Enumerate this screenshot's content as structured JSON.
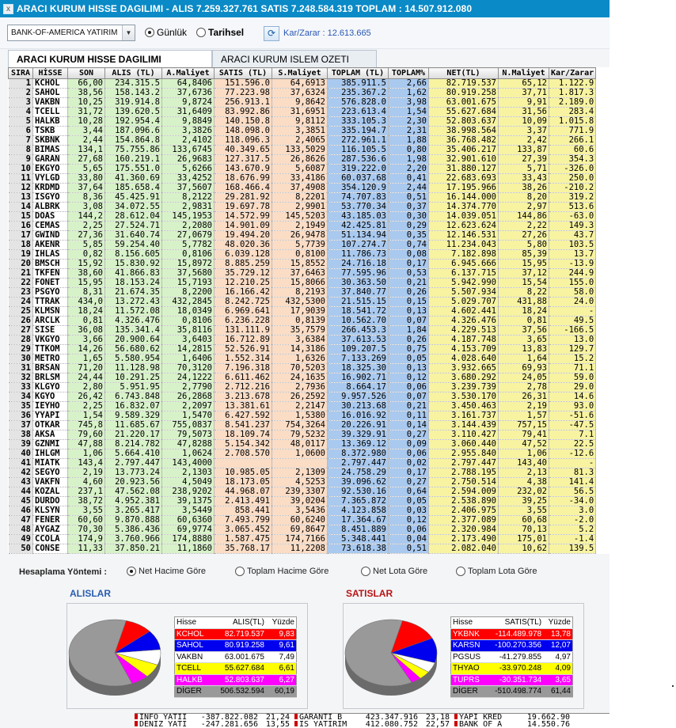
{
  "window": {
    "title": "ARACI KURUM HISSE DAGILIMI - ALIS 7.259.327.761  SATIS 7.248.584.319  TOPLAM : 14.507.912.080",
    "close_glyph": "x"
  },
  "toolbar": {
    "broker_select": "BANK-OF-AMERICA YATIRIM",
    "radio_gunluk": "Günlük",
    "radio_tarihsel": "Tarihsel",
    "selected_mode": "Günlük",
    "kar_zarar": "Kar/Zarar : 12.613.665"
  },
  "tabs": [
    {
      "label": "ARACI KURUM HISSE DAGILIMI",
      "active": true
    },
    {
      "label": "ARACI KURUM ISLEM OZETI",
      "active": false
    }
  ],
  "grid": {
    "columns": [
      "SIRA",
      "HİSSE",
      "SON",
      "ALIS (TL)",
      "A.Maliyet",
      "SATIS (TL)",
      "S.Maliyet",
      "TOPLAM (TL)",
      "TOPLAM%",
      "NET(TL)",
      "N.Maliyet",
      "Kar/Zarar"
    ],
    "rows": [
      [
        "1",
        "KCHOL",
        "66,00",
        "234.315.5",
        "64,8406",
        "151.596.0",
        "64,6913",
        "385.911.5",
        "2,66",
        "82.719.537",
        "65,12",
        "1.122.9"
      ],
      [
        "2",
        "SAHOL",
        "38,56",
        "158.143.2",
        "37,6736",
        "77.223.98",
        "37,6324",
        "235.367.2",
        "1,62",
        "80.919.258",
        "37,71",
        "1.817.3"
      ],
      [
        "3",
        "VAKBN",
        "10,25",
        "319.914.8",
        "9,8724",
        "256.913.1",
        "9,8642",
        "576.828.0",
        "3,98",
        "63.001.675",
        "9,91",
        "2.189.0"
      ],
      [
        "4",
        "TCELL",
        "31,72",
        "139.620.5",
        "31,6409",
        "83.992.86",
        "31,6951",
        "223.613.4",
        "1,54",
        "55.627.684",
        "31,56",
        "283.4"
      ],
      [
        "5",
        "HALKB",
        "10,28",
        "192.954.4",
        "9,8849",
        "140.150.8",
        "9,8112",
        "333.105.3",
        "2,30",
        "52.803.637",
        "10,09",
        "1.015.8"
      ],
      [
        "6",
        "TSKB",
        "3,44",
        "187.096.6",
        "3,3826",
        "148.098.0",
        "3,3851",
        "335.194.7",
        "2,31",
        "38.998.564",
        "3,37",
        "771.9"
      ],
      [
        "7",
        "SKBNK",
        "2,44",
        "154.864.8",
        "2,4102",
        "118.096.3",
        "2,4065",
        "272.961.1",
        "1,88",
        "36.768.482",
        "2,42",
        "266.1"
      ],
      [
        "8",
        "BIMAS",
        "134,1",
        "75.755.86",
        "133,6745",
        "40.349.65",
        "133,5029",
        "116.105.5",
        "0,80",
        "35.406.217",
        "133,87",
        "60.6"
      ],
      [
        "9",
        "GARAN",
        "27,68",
        "160.219.1",
        "26,9683",
        "127.317.5",
        "26,8626",
        "287.536.6",
        "1,98",
        "32.901.610",
        "27,39",
        "354.3"
      ],
      [
        "10",
        "EKGYO",
        "5,65",
        "175.551.0",
        "5,6266",
        "143.670.9",
        "5,6087",
        "319.222.0",
        "2,20",
        "31.880.127",
        "5,71",
        "-326.0"
      ],
      [
        "11",
        "VYLGD",
        "33,80",
        "41.360.69",
        "33,4252",
        "18.676.99",
        "33,4186",
        "60.037.68",
        "0,41",
        "22.683.693",
        "33,43",
        "250.0"
      ],
      [
        "12",
        "KRDMD",
        "37,64",
        "185.658.4",
        "37,5607",
        "168.466.4",
        "37,4908",
        "354.120.9",
        "2,44",
        "17.195.966",
        "38,26",
        "-210.2"
      ],
      [
        "13",
        "ISGYO",
        "8,36",
        "45.425.91",
        "8,2122",
        "29.281.92",
        "8,2201",
        "74.707.83",
        "0,51",
        "16.144.000",
        "8,20",
        "319.2"
      ],
      [
        "14",
        "ALBRK",
        "3,08",
        "34.072.55",
        "2,9831",
        "19.697.78",
        "2,9901",
        "53.770.34",
        "0,37",
        "14.374.770",
        "2,97",
        "513.6"
      ],
      [
        "15",
        "DOAS",
        "144,2",
        "28.612.04",
        "145,1953",
        "14.572.99",
        "145,5203",
        "43.185.03",
        "0,30",
        "14.039.051",
        "144,86",
        "-63.0"
      ],
      [
        "16",
        "CEMAS",
        "2,25",
        "27.524.71",
        "2,2080",
        "14.901.09",
        "2,1949",
        "42.425.81",
        "0,29",
        "12.623.624",
        "2,22",
        "149.3"
      ],
      [
        "17",
        "GWIND",
        "27,36",
        "31.640.74",
        "27,0679",
        "19.494.20",
        "26,9478",
        "51.134.94",
        "0,35",
        "12.146.531",
        "27,26",
        "43.7"
      ],
      [
        "18",
        "AKENR",
        "5,85",
        "59.254.40",
        "5,7782",
        "48.020.36",
        "5,7739",
        "107.274.7",
        "0,74",
        "11.234.043",
        "5,80",
        "103.5"
      ],
      [
        "19",
        "IHLAS",
        "0,82",
        "8.156.605",
        "0,8106",
        "6.039.128",
        "0,8100",
        "11.786.73",
        "0,08",
        "7.182.898",
        "85,39",
        "13.7"
      ],
      [
        "20",
        "BMSCH",
        "15,92",
        "15.830.92",
        "15,8972",
        "8.885.259",
        "15,8552",
        "24.716.18",
        "0,17",
        "6.945.666",
        "15,95",
        "-13.9"
      ],
      [
        "21",
        "TKFEN",
        "38,60",
        "41.866.83",
        "37,5680",
        "35.729.12",
        "37,6463",
        "77.595.96",
        "0,53",
        "6.137.715",
        "37,12",
        "244.9"
      ],
      [
        "22",
        "FONET",
        "15,95",
        "18.153.24",
        "15,7193",
        "12.210.25",
        "15,8066",
        "30.363.50",
        "0,21",
        "5.942.990",
        "15,54",
        "155.0"
      ],
      [
        "23",
        "PSGYO",
        "8,31",
        "21.674.35",
        "8,2200",
        "16.166.42",
        "8,2193",
        "37.840.77",
        "0,26",
        "5.507.934",
        "8,22",
        "58.0"
      ],
      [
        "24",
        "TTRAK",
        "434,0",
        "13.272.43",
        "432,2845",
        "8.242.725",
        "432,5300",
        "21.515.15",
        "0,15",
        "5.029.707",
        "431,88",
        "24.0"
      ],
      [
        "25",
        "KLMSN",
        "18,24",
        "11.572.08",
        "18,0349",
        "6.969.641",
        "17,9039",
        "18.541.72",
        "0,13",
        "4.602.441",
        "18,24",
        "-"
      ],
      [
        "26",
        "ARCLK",
        "0,81",
        "4.326.476",
        "0,8106",
        "6.236.228",
        "0,8139",
        "10.562.70",
        "0,07",
        "4.326.476",
        "0,81",
        "49.5"
      ],
      [
        "27",
        "SISE",
        "36,08",
        "135.341.4",
        "35,8116",
        "131.111.9",
        "35,7579",
        "266.453.3",
        "1,84",
        "4.229.513",
        "37,56",
        "-166.5"
      ],
      [
        "28",
        "VKGYO",
        "3,66",
        "20.900.64",
        "3,6403",
        "16.712.89",
        "3,6384",
        "37.613.53",
        "0,26",
        "4.187.748",
        "3,65",
        "13.0"
      ],
      [
        "29",
        "TTKOM",
        "14,26",
        "56.680.62",
        "14,2815",
        "52.526.91",
        "14,3186",
        "109.207.5",
        "0,75",
        "4.153.709",
        "13,83",
        "129.7"
      ],
      [
        "30",
        "METRO",
        "1,65",
        "5.580.954",
        "1,6406",
        "1.552.314",
        "1,6326",
        "7.133.269",
        "0,05",
        "4.028.640",
        "1,64",
        "15.2"
      ],
      [
        "31",
        "BRSAN",
        "71,20",
        "11.128.98",
        "70,3120",
        "7.196.318",
        "70,5203",
        "18.325.30",
        "0,13",
        "3.932.665",
        "69,93",
        "71.1"
      ],
      [
        "32",
        "BRLSM",
        "24,44",
        "10.291.25",
        "24,1222",
        "6.611.462",
        "24,1635",
        "16.902.71",
        "0,12",
        "3.680.292",
        "24,05",
        "59.0"
      ],
      [
        "33",
        "KLGYO",
        "2,80",
        "5.951.95",
        "2,7790",
        "2.712.216",
        "2,7936",
        "8.664.17",
        "0,06",
        "3.239.739",
        "2,78",
        "29.0"
      ],
      [
        "34",
        "KGYO",
        "26,42",
        "6.743.848",
        "26,2868",
        "3.213.678",
        "26,2592",
        "9.957.526",
        "0,07",
        "3.530.170",
        "26,31",
        "14.6"
      ],
      [
        "35",
        "IEYHO",
        "2,25",
        "16.832.07",
        "2,2097",
        "13.381.61",
        "2,2147",
        "30.213.68",
        "0,21",
        "3.450.463",
        "2,19",
        "93.0"
      ],
      [
        "36",
        "YYAPI",
        "1,54",
        "9.589.329",
        "1,5470",
        "6.427.592",
        "1,5380",
        "16.016.92",
        "0,11",
        "3.161.737",
        "1,57",
        "-51.6"
      ],
      [
        "37",
        "OTKAR",
        "745,8",
        "11.685.67",
        "755,0837",
        "8.541.237",
        "754,3264",
        "20.226.91",
        "0,14",
        "3.144.439",
        "757,15",
        "-47.5"
      ],
      [
        "38",
        "AKSA",
        "79,60",
        "21.220.17",
        "79,5073",
        "18.109.74",
        "79,5232",
        "39.329.91",
        "0,27",
        "3.110.427",
        "79,41",
        "7.1"
      ],
      [
        "39",
        "GZNMI",
        "47,88",
        "8.214.782",
        "47,8288",
        "5.154.342",
        "48,0117",
        "13.369.12",
        "0,09",
        "3.060.440",
        "47,52",
        "22.5"
      ],
      [
        "40",
        "IHLGM",
        "1,06",
        "5.664.410",
        "1,0624",
        "2.708.570",
        "1,0600",
        "8.372.980",
        "0,06",
        "2.955.840",
        "1,06",
        "-12.6"
      ],
      [
        "41",
        "MIATK",
        "143,4",
        "2.797.447",
        "143,4000",
        "",
        "",
        "2.797.447",
        "0,02",
        "2.797.447",
        "143,40",
        "-"
      ],
      [
        "42",
        "SEGYO",
        "2,19",
        "13.773.24",
        "2,1303",
        "10.985.05",
        "2,1309",
        "24.758.29",
        "0,17",
        "2.788.195",
        "2,13",
        "81.3"
      ],
      [
        "43",
        "VAKFN",
        "4,60",
        "20.923.56",
        "4,5049",
        "18.173.05",
        "4,5253",
        "39.096.62",
        "0,27",
        "2.750.514",
        "4,38",
        "141.4"
      ],
      [
        "44",
        "KOZAL",
        "237,1",
        "47.562.08",
        "238,9202",
        "44.968.07",
        "239,3307",
        "92.530.16",
        "0,64",
        "2.594.009",
        "232,02",
        "56.5"
      ],
      [
        "45",
        "DURDO",
        "38,72",
        "4.952.381",
        "39,1375",
        "2.413.491",
        "39,0204",
        "7.365.872",
        "0,05",
        "2.538.890",
        "39,25",
        "-34.0"
      ],
      [
        "46",
        "KLSYN",
        "3,55",
        "3.265.417",
        "3,5449",
        "858.441",
        "3,5436",
        "4.123.858",
        "0,03",
        "2.406.975",
        "3,55",
        "3.0"
      ],
      [
        "47",
        "FENER",
        "60,60",
        "9.870.888",
        "60,6360",
        "7.493.799",
        "60,6240",
        "17.364.67",
        "0,12",
        "2.377.089",
        "60,68",
        "-2.0"
      ],
      [
        "48",
        "AYGAZ",
        "70,30",
        "5.386.436",
        "69,9774",
        "3.065.452",
        "69,8647",
        "8.451.889",
        "0,06",
        "2.320.984",
        "70,13",
        "5.2"
      ],
      [
        "49",
        "CCOLA",
        "174,9",
        "3.760.966",
        "174,8880",
        "1.587.475",
        "174,7166",
        "5.348.441",
        "0,04",
        "2.173.490",
        "175,01",
        "-1.4"
      ],
      [
        "50",
        "CONSE",
        "11,33",
        "37.850.21",
        "11,1860",
        "35.768.17",
        "11,2208",
        "73.618.38",
        "0,51",
        "2.082.040",
        "10,62",
        "139.5"
      ]
    ]
  },
  "hesaplama": {
    "label": "Hesaplama Yöntemi :",
    "options": [
      "Net Hacime Göre",
      "Toplam Hacime Göre",
      "Net Lota Göre",
      "Toplam Lota Göre"
    ],
    "selected": "Net Hacime Göre"
  },
  "alislar": {
    "title": "ALISLAR",
    "title_color": "#2a5db0",
    "headers": [
      "Hisse",
      "ALIS(TL)",
      "Yüzde"
    ],
    "rows": [
      {
        "name": "KCHOL",
        "value": "82.719.537",
        "pct": "9,83",
        "pct_num": 9.83,
        "bg": "#ff0000",
        "fg": "#ffffff"
      },
      {
        "name": "SAHOL",
        "value": "80.919.258",
        "pct": "9,61",
        "pct_num": 9.61,
        "bg": "#0000ee",
        "fg": "#ffffff"
      },
      {
        "name": "VAKBN",
        "value": "63.001.675",
        "pct": "7,49",
        "pct_num": 7.49,
        "bg": "#ffffff",
        "fg": "#000000"
      },
      {
        "name": "TCELL",
        "value": "55.627.684",
        "pct": "6,61",
        "pct_num": 6.61,
        "bg": "#ffff00",
        "fg": "#000000"
      },
      {
        "name": "HALKB",
        "value": "52.803.637",
        "pct": "6,27",
        "pct_num": 6.27,
        "bg": "#ff00ff",
        "fg": "#ffffff"
      },
      {
        "name": "DİGER",
        "value": "506.532.594",
        "pct": "60,19",
        "pct_num": 60.19,
        "bg": "#999999",
        "fg": "#000000"
      }
    ]
  },
  "satislar": {
    "title": "SATISLAR",
    "title_color": "#b81414",
    "headers": [
      "Hisse",
      "SATIS(TL)",
      "Yüzde"
    ],
    "rows": [
      {
        "name": "YKBNK",
        "value": "-114.489.978",
        "pct": "13,78",
        "pct_num": 13.78,
        "bg": "#ff0000",
        "fg": "#ffffff"
      },
      {
        "name": "KARSN",
        "value": "-100.270.356",
        "pct": "12,07",
        "pct_num": 12.07,
        "bg": "#0000ee",
        "fg": "#ffffff"
      },
      {
        "name": "PGSUS",
        "value": "-41.279.855",
        "pct": "4,97",
        "pct_num": 4.97,
        "bg": "#ffffff",
        "fg": "#000000"
      },
      {
        "name": "THYAO",
        "value": "-33.970.248",
        "pct": "4,09",
        "pct_num": 4.09,
        "bg": "#ffff00",
        "fg": "#000000"
      },
      {
        "name": "TUPRS",
        "value": "-30.351.734",
        "pct": "3,65",
        "pct_num": 3.65,
        "bg": "#ff00ff",
        "fg": "#ffffff"
      },
      {
        "name": "DİGER",
        "value": "-510.498.774",
        "pct": "61,44",
        "pct_num": 61.44,
        "bg": "#999999",
        "fg": "#000000"
      }
    ]
  },
  "bottom_strip": {
    "row1": [
      "INFO YATII",
      "-387.822.082",
      "21,24",
      "GARANTI B",
      "423.347.916",
      "23,18",
      "YAPI KRED",
      "19.662.90"
    ],
    "row2": [
      "DENIZ YATI",
      "-247.281.656",
      "13,55",
      "IS YATIRIM",
      "412.080.752",
      "22,57",
      "BANK OF A",
      "14.550.76"
    ]
  },
  "colors": {
    "titlebar": "#0a8ac6",
    "alis_cols": "#d7f2c8",
    "satis_cols": "#fbdcc5",
    "toplam_cols": "#a9c9ef",
    "net_cols": "#f7f3a0"
  }
}
